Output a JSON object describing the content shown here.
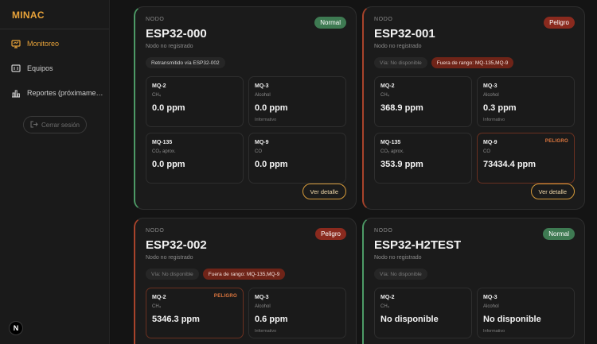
{
  "app": {
    "brand": "MINAC",
    "nav": [
      {
        "label": "Monitoreo",
        "icon": "monitor-icon"
      },
      {
        "label": "Equipos",
        "icon": "equipment-icon"
      },
      {
        "label": "Reportes (próximame…",
        "icon": "chart-icon"
      }
    ],
    "logout_label": "Cerrar sesión",
    "logo_letter": "N"
  },
  "colors": {
    "accent": "#e8a33a",
    "normal": "#3e7a52",
    "danger": "#8a2a1e"
  },
  "cards": [
    {
      "label": "NODO",
      "title": "ESP32-000",
      "subtitle": "Nodo no registrado",
      "status": "Normal",
      "chips": [
        "Retransmitido vía ESP32-002"
      ],
      "sensors": [
        {
          "name": "MQ-2",
          "gas": "CH₄",
          "value": "0.0 ppm",
          "note": "",
          "flag": ""
        },
        {
          "name": "MQ-3",
          "gas": "Alcohol",
          "value": "0.0 ppm",
          "note": "Informativo",
          "flag": ""
        },
        {
          "name": "MQ-135",
          "gas": "CO₂ aprox.",
          "value": "0.0 ppm",
          "note": "",
          "flag": ""
        },
        {
          "name": "MQ-9",
          "gas": "CO",
          "value": "0.0 ppm",
          "note": "",
          "flag": ""
        }
      ],
      "detail_label": "Ver detalle"
    },
    {
      "label": "NODO",
      "title": "ESP32-001",
      "subtitle": "Nodo no registrado",
      "status": "Peligro",
      "chips": [
        "Vía: No disponible",
        "Fuera de rango: MQ-135,MQ-9"
      ],
      "sensors": [
        {
          "name": "MQ-2",
          "gas": "CH₄",
          "value": "368.9 ppm",
          "note": "",
          "flag": ""
        },
        {
          "name": "MQ-3",
          "gas": "Alcohol",
          "value": "0.3 ppm",
          "note": "Informativo",
          "flag": ""
        },
        {
          "name": "MQ-135",
          "gas": "CO₂ aprox.",
          "value": "353.9 ppm",
          "note": "",
          "flag": ""
        },
        {
          "name": "MQ-9",
          "gas": "CO",
          "value": "73434.4 ppm",
          "note": "",
          "flag": "PELIGRO"
        }
      ],
      "detail_label": "Ver detalle"
    },
    {
      "label": "NODO",
      "title": "ESP32-002",
      "subtitle": "Nodo no registrado",
      "status": "Peligro",
      "chips": [
        "Vía: No disponible",
        "Fuera de rango: MQ-135,MQ-9"
      ],
      "sensors": [
        {
          "name": "MQ-2",
          "gas": "CH₄",
          "value": "5346.3 ppm",
          "note": "",
          "flag": "PELIGRO"
        },
        {
          "name": "MQ-3",
          "gas": "Alcohol",
          "value": "0.6 ppm",
          "note": "Informativo",
          "flag": ""
        }
      ]
    },
    {
      "label": "NODO",
      "title": "ESP32-H2TEST",
      "subtitle": "Nodo no registrado",
      "status": "Normal",
      "chips": [
        "Vía: No disponible"
      ],
      "sensors": [
        {
          "name": "MQ-2",
          "gas": "CH₄",
          "value": "No disponible",
          "note": "",
          "flag": ""
        },
        {
          "name": "MQ-3",
          "gas": "Alcohol",
          "value": "No disponible",
          "note": "Informativo",
          "flag": ""
        }
      ]
    }
  ]
}
